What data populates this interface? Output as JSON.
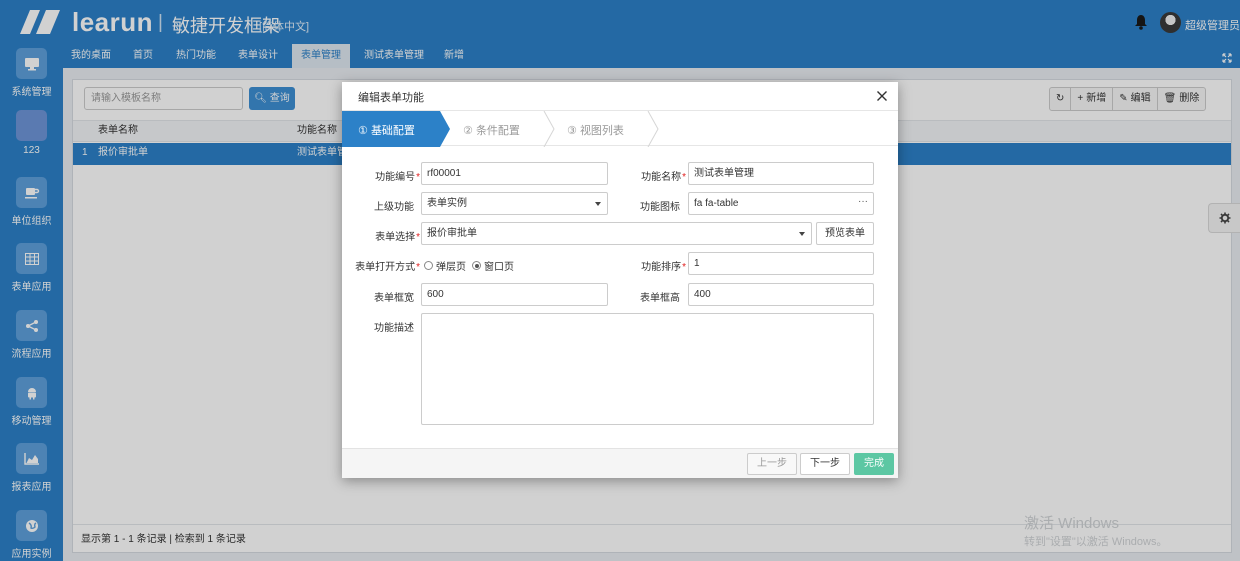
{
  "header": {
    "logo_text": "learun",
    "separator": "|",
    "subtitle": "敏捷开发框架",
    "language": "[简体中文]",
    "username": "超级管理员"
  },
  "sidebar": {
    "items": [
      {
        "label": "系统管理",
        "icon": "monitor-icon"
      },
      {
        "label": "123",
        "icon": "blank-icon"
      },
      {
        "label": "单位组织",
        "icon": "coffee-icon"
      },
      {
        "label": "表单应用",
        "icon": "table-icon"
      },
      {
        "label": "流程应用",
        "icon": "share-icon"
      },
      {
        "label": "移动管理",
        "icon": "android-icon"
      },
      {
        "label": "报表应用",
        "icon": "area-chart-icon"
      },
      {
        "label": "应用实例",
        "icon": "globe-icon"
      }
    ]
  },
  "tabs": [
    {
      "label": "我的桌面",
      "active": false
    },
    {
      "label": "首页",
      "active": false
    },
    {
      "label": "热门功能",
      "active": false
    },
    {
      "label": "表单设计",
      "active": false
    },
    {
      "label": "表单管理",
      "active": true
    },
    {
      "label": "测试表单管理",
      "active": false
    },
    {
      "label": "新增",
      "active": false
    }
  ],
  "search": {
    "placeholder": "请输入模板名称",
    "button_label": "查询"
  },
  "toolbar": {
    "add_label": "新增",
    "edit_label": "编辑",
    "delete_label": "删除"
  },
  "grid": {
    "columns": [
      "表单名称",
      "功能名称"
    ],
    "rows": [
      {
        "index": "1",
        "form_name": "报价审批单",
        "function_name": "测试表单管"
      }
    ],
    "status": "显示第 1 - 1 条记录 | 检索到 1 条记录"
  },
  "watermark": {
    "line1": "激活 Windows",
    "line2": "转到\"设置\"以激活 Windows。"
  },
  "modal": {
    "title": "编辑表单功能",
    "steps": [
      {
        "number": "①",
        "label": "基础配置",
        "active": true
      },
      {
        "number": "②",
        "label": "条件配置",
        "active": false
      },
      {
        "number": "③",
        "label": "视图列表",
        "active": false
      }
    ],
    "form": {
      "code_label": "功能编号",
      "code_value": "rf00001",
      "name_label": "功能名称",
      "name_value": "测试表单管理",
      "parent_label": "上级功能",
      "parent_value": "表单实例",
      "icon_label": "功能图标",
      "icon_value": "fa fa-table",
      "icon_picker": "···",
      "form_label": "表单选择",
      "form_value": "报价审批单",
      "preview_label": "预览表单",
      "open_label": "表单打开方式",
      "open_options": [
        "弹层页",
        "窗口页"
      ],
      "open_selected": "窗口页",
      "sort_label": "功能排序",
      "sort_value": "1",
      "width_label": "表单框宽",
      "width_value": "600",
      "height_label": "表单框高",
      "height_value": "400",
      "desc_label": "功能描述",
      "desc_value": "",
      "required_mark": "*"
    },
    "footer": {
      "prev_label": "上一步",
      "next_label": "下一步",
      "finish_label": "完成"
    }
  },
  "colors": {
    "brand": "#2c81c8",
    "step_active": "#2c81c8",
    "finish_button": "#5cc7a3",
    "required": "#e02020"
  }
}
